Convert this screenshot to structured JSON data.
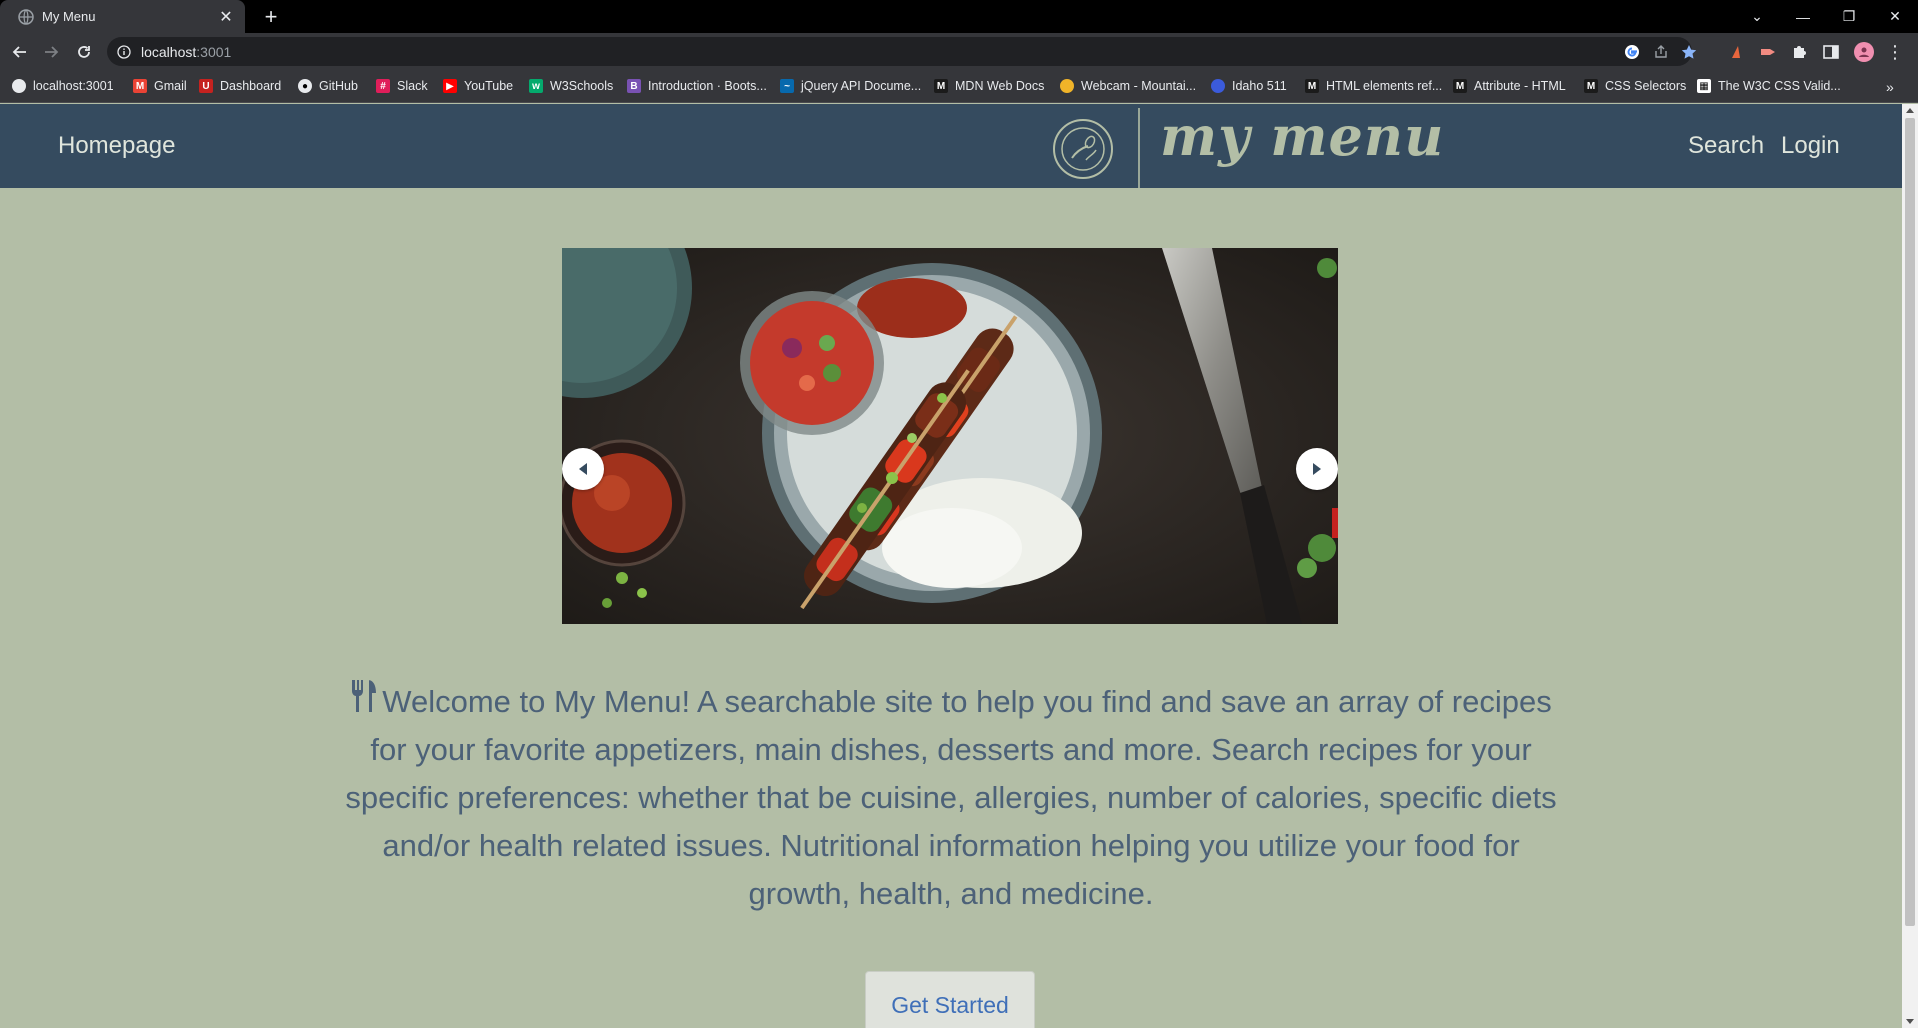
{
  "browser": {
    "tab_title": "My Menu",
    "url_host": "localhost",
    "url_port": ":3001",
    "bookmarks": [
      {
        "label": "localhost:3001",
        "icon": "globe-icon",
        "color": "#e8eaed"
      },
      {
        "label": "Gmail",
        "icon": "gmail-icon",
        "color": "#ea4335"
      },
      {
        "label": "Dashboard",
        "icon": "dashboard-icon",
        "color": "#c5221f"
      },
      {
        "label": "GitHub",
        "icon": "github-icon",
        "color": "#e8eaed"
      },
      {
        "label": "Slack",
        "icon": "slack-icon",
        "color": "#e01e5a"
      },
      {
        "label": "YouTube",
        "icon": "youtube-icon",
        "color": "#ff0000"
      },
      {
        "label": "W3Schools",
        "icon": "w3schools-icon",
        "color": "#04aa6d"
      },
      {
        "label": "Introduction · Boots...",
        "icon": "bootstrap-icon",
        "color": "#7952b3"
      },
      {
        "label": "jQuery API Docume...",
        "icon": "jquery-icon",
        "color": "#0769ad"
      },
      {
        "label": "MDN Web Docs",
        "icon": "mdn-icon",
        "color": "#1b1b1b"
      },
      {
        "label": "Webcam - Mountai...",
        "icon": "webcam-icon",
        "color": "#f0b429"
      },
      {
        "label": "Idaho 511",
        "icon": "idaho511-icon",
        "color": "#3b5bdb"
      },
      {
        "label": "HTML elements ref...",
        "icon": "mdn-icon",
        "color": "#1b1b1b"
      },
      {
        "label": "Attribute - HTML",
        "icon": "mdn-icon",
        "color": "#1b1b1b"
      },
      {
        "label": "CSS Selectors",
        "icon": "mdn-icon",
        "color": "#1b1b1b"
      },
      {
        "label": "The W3C CSS Valid...",
        "icon": "w3c-icon",
        "color": "#ffffff"
      }
    ]
  },
  "site": {
    "nav": {
      "home": "Homepage",
      "logo_text": "my menu",
      "search": "Search",
      "login": "Login"
    },
    "welcome_text": "Welcome to My Menu! A searchable site to help you find and save an array of recipes for your favorite appetizers, main dishes, desserts and more. Search recipes for your specific preferences: whether that be cuisine, allergies, number of calories, specific diets and/or health related issues. Nutritional information helping you utilize your food for growth, health, and medicine.",
    "get_started": "Get Started"
  },
  "colors": {
    "page_bg": "#b3bea6",
    "nav_bg": "#354b5f",
    "text": "#4c6178",
    "button_text": "#3f6fb8"
  }
}
